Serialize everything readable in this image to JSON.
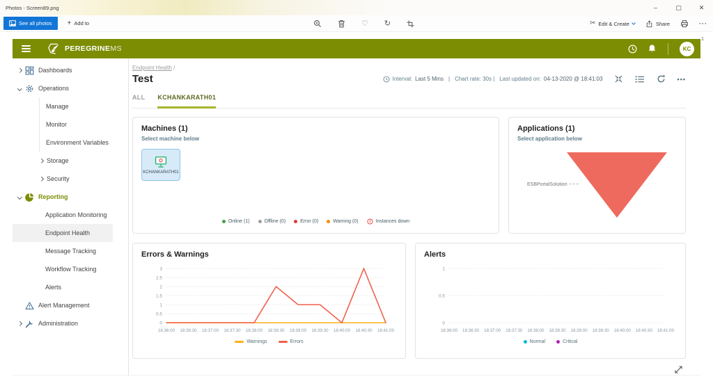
{
  "photos_app": {
    "title": "Photos - Screen89.png",
    "window_controls": {
      "minimize": "–",
      "maximize": "▢",
      "close": "✕"
    },
    "toolbar": {
      "see_all_photos": "See all photos",
      "add_to": "Add to",
      "plus": "+",
      "heart": "♡",
      "rotate": "↻",
      "scissors": "✂",
      "edit_create": "Edit & Create",
      "share": "Share",
      "more": "···"
    },
    "expand_hint": "⤢"
  },
  "app": {
    "brand": {
      "name_bold": "PEREGRINE",
      "name_light": "MS",
      "color": "#7c8d03"
    },
    "header": {
      "avatar": "KC",
      "badge": "1"
    },
    "sidebar": {
      "items": [
        {
          "label": "Dashboards"
        },
        {
          "label": "Operations"
        },
        {
          "label": "Manage"
        },
        {
          "label": "Monitor"
        },
        {
          "label": "Environment Variables"
        },
        {
          "label": "Storage"
        },
        {
          "label": "Security"
        },
        {
          "label": "Reporting"
        },
        {
          "label": "Application Monitoring"
        },
        {
          "label": "Endpoint Health"
        },
        {
          "label": "Message Tracking"
        },
        {
          "label": "Workflow Tracking"
        },
        {
          "label": "Alerts"
        },
        {
          "label": "Alert Management"
        },
        {
          "label": "Administration"
        }
      ]
    },
    "page": {
      "breadcrumb": "Endpoint Health",
      "breadcrumb_sep": " /",
      "title": "Test",
      "info": {
        "interval_label": "Interval:",
        "interval_value": "Last 5 Mins",
        "divider": "|",
        "chart_rate": "Chart rate: 30s |",
        "updated_label": "Last updated on:",
        "updated_value": "04-13-2020 @ 18:41:03"
      },
      "more": "•••"
    },
    "tabs": [
      {
        "label": "ALL"
      },
      {
        "label": "KCHANKARATH01"
      }
    ],
    "machines": {
      "title": "Machines (1)",
      "subtitle": "Select machine below",
      "tile_label": "KCHANKARATH01",
      "legend": [
        {
          "label": "Online (1)",
          "color": "#43a047"
        },
        {
          "label": "Offline (0)",
          "color": "#9e9e9e"
        },
        {
          "label": "Error (0)",
          "color": "#e53935"
        },
        {
          "label": "Warning (0)",
          "color": "#fb8c00"
        },
        {
          "label": "Instances down",
          "icon": "alert-circle-icon",
          "color": "#e53935"
        }
      ]
    },
    "applications": {
      "title": "Applications (1)",
      "subtitle": "Select application below",
      "funnel_label": "ESBPortalSolution",
      "funnel_color": "#ee6a5e"
    }
  },
  "chart_data": [
    {
      "type": "line",
      "title": "Errors & Warnings",
      "x": [
        "18:36:00",
        "18:36:30",
        "18:37:00",
        "18:37:30",
        "18:38:00",
        "18:38:30",
        "18:39:00",
        "18:39:30",
        "18:40:00",
        "18:40:30",
        "18:41:00"
      ],
      "series": [
        {
          "name": "Warnings",
          "color": "#fcaf17",
          "values": [
            0,
            0,
            0,
            0,
            0,
            0,
            0,
            0,
            0,
            0,
            0
          ]
        },
        {
          "name": "Errors",
          "color": "#f1604d",
          "values": [
            0,
            0,
            0,
            0,
            0,
            2,
            1,
            1,
            0,
            3,
            0
          ]
        }
      ],
      "ylim": [
        0,
        3
      ],
      "yticks": [
        0,
        0.5,
        1,
        1.5,
        2,
        2.5,
        3
      ],
      "grid": "dotted",
      "legend_position": "bottom",
      "legend_marker": "line"
    },
    {
      "type": "line",
      "title": "Alerts",
      "x": [
        "18:36:00",
        "18:36:30",
        "18:37:00",
        "18:37:30",
        "18:38:00",
        "18:38:30",
        "18:39:00",
        "18:39:30",
        "18:40:00",
        "18:40:30",
        "18:41:00"
      ],
      "series": [
        {
          "name": "Normal",
          "color": "#00b8d9",
          "values": []
        },
        {
          "name": "Critical",
          "color": "#b023b5",
          "values": []
        }
      ],
      "ylim": [
        0,
        1
      ],
      "yticks": [
        0,
        0.5,
        1
      ],
      "grid": "dotted",
      "legend_position": "bottom",
      "legend_marker": "dot"
    }
  ]
}
